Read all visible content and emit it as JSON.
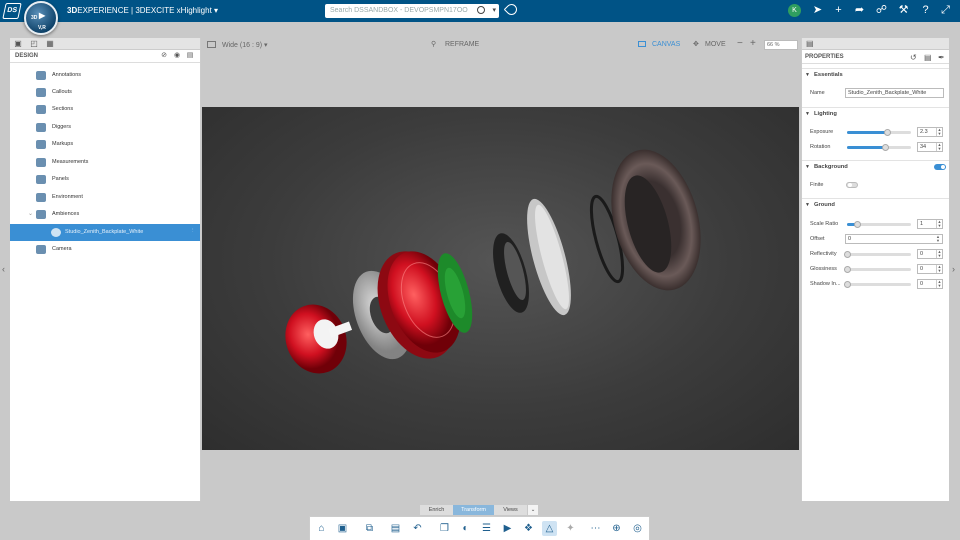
{
  "topbar": {
    "brand_bold": "3D",
    "brand": "EXPERIENCE | 3DEXCITE xHighlight",
    "compass_top": "3D",
    "compass_bottom": "V,R",
    "search_placeholder": "Search DSSANDBOX - DEVOPSMPN17OO",
    "user_initial": "K",
    "icons": [
      "tag-icon",
      "share-icon",
      "add-icon",
      "forward-icon",
      "network-icon",
      "tools-icon",
      "help-icon",
      "maximize-icon"
    ]
  },
  "left_panel": {
    "title": "DESIGN",
    "items": [
      {
        "label": "Annotations",
        "icon": "annotations-icon",
        "selected": false
      },
      {
        "label": "Callouts",
        "icon": "callouts-icon",
        "selected": false
      },
      {
        "label": "Sections",
        "icon": "sections-icon",
        "selected": false
      },
      {
        "label": "Diggers",
        "icon": "diggers-icon",
        "selected": false
      },
      {
        "label": "Markups",
        "icon": "markups-icon",
        "selected": false
      },
      {
        "label": "Measurements",
        "icon": "measurements-icon",
        "selected": false
      },
      {
        "label": "Panels",
        "icon": "panels-icon",
        "selected": false
      },
      {
        "label": "Environment",
        "icon": "environment-icon",
        "selected": false
      },
      {
        "label": "Ambiences",
        "icon": "ambiences-icon",
        "selected": false
      },
      {
        "label": "Studio_Zenith_Backplate_White",
        "icon": "ambience-sphere-icon",
        "selected": true
      },
      {
        "label": "Camera",
        "icon": "camera-icon",
        "selected": false
      }
    ]
  },
  "viewport_bar": {
    "aspect": "Wide (16 : 9)",
    "reframe": "REFRAME",
    "canvas": "CANVAS",
    "move": "MOVE",
    "zoom": "66 %"
  },
  "properties": {
    "title": "PROPERTIES",
    "essentials": {
      "header": "Essentials",
      "name_label": "Name",
      "name_value": "Studio_Zenith_Backplate_White"
    },
    "lighting": {
      "header": "Lighting",
      "exposure_label": "Exposure",
      "exposure_value": "2.3",
      "exposure_level": 0.63,
      "rotation_label": "Rotation",
      "rotation_value": "34",
      "rotation_level": 0.6
    },
    "background": {
      "header": "Background",
      "enabled": true,
      "finite_label": "Finite",
      "finite": false
    },
    "ground": {
      "header": "Ground",
      "scale_label": "Scale Ratio",
      "scale_value": "1",
      "scale_level": 0.15,
      "offset_label": "Offset",
      "offset_value": "0",
      "reflectivity_label": "Reflectivity",
      "reflectivity_value": "0",
      "glossiness_label": "Glossiness",
      "glossiness_value": "0",
      "shadow_label": "Shadow In...",
      "shadow_value": "0"
    }
  },
  "mode_tabs": {
    "enrich": "Enrich",
    "transform": "Transform",
    "views": "Views",
    "active": "Transform"
  },
  "toolbar_icons": [
    "home-icon",
    "save-icon",
    "export-icon",
    "image-icon",
    "undo-icon",
    "copy-icon",
    "render-icon",
    "layers-icon",
    "play-icon",
    "3d-object-icon",
    "pyramid-icon",
    "sparkle-icon",
    "link-icon",
    "target-icon",
    "globe-icon"
  ],
  "colors": {
    "topbar": "#005386",
    "accent": "#3a8fd4",
    "selected": "#3a8fd4"
  }
}
